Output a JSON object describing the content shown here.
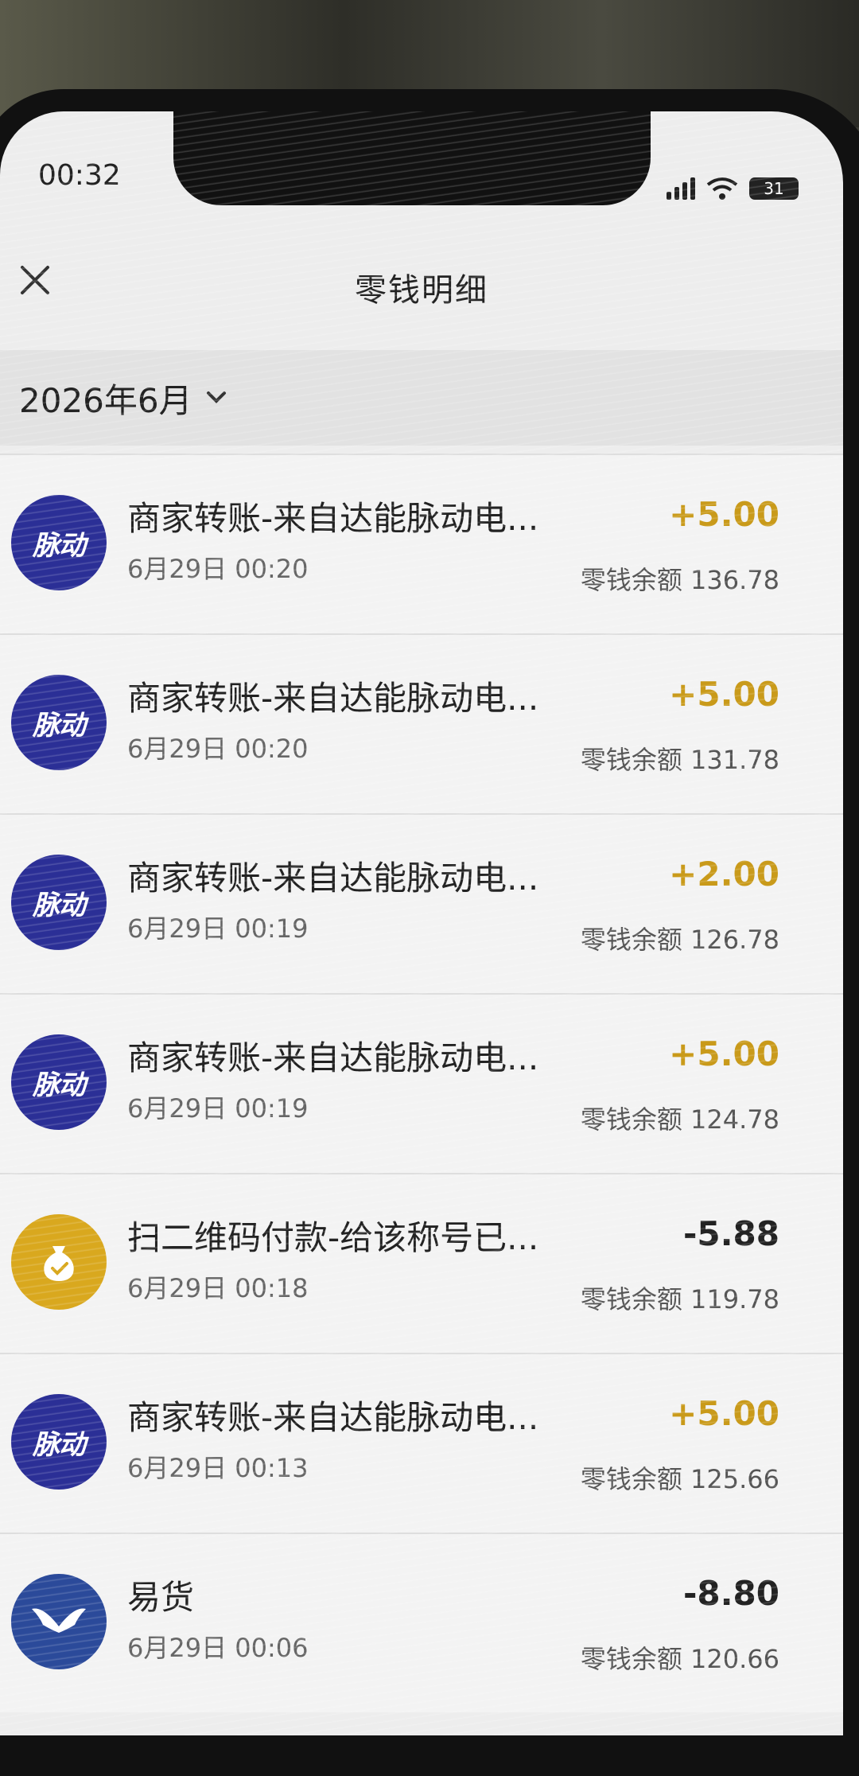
{
  "status_bar": {
    "time": "00:32",
    "battery": "31"
  },
  "nav": {
    "title": "零钱明细"
  },
  "filter": {
    "month": "2026年6月"
  },
  "transactions": [
    {
      "avatar_text": "脉动",
      "avatar_type": "brand",
      "title": "商家转账-来自达能脉动电...",
      "time": "6月29日 00:20",
      "amount": "+5.00",
      "balance": "零钱余额 136.78",
      "direction": "positive"
    },
    {
      "avatar_text": "脉动",
      "avatar_type": "brand",
      "title": "商家转账-来自达能脉动电...",
      "time": "6月29日 00:20",
      "amount": "+5.00",
      "balance": "零钱余额 131.78",
      "direction": "positive"
    },
    {
      "avatar_text": "脉动",
      "avatar_type": "brand",
      "title": "商家转账-来自达能脉动电...",
      "time": "6月29日 00:19",
      "amount": "+2.00",
      "balance": "零钱余额 126.78",
      "direction": "positive"
    },
    {
      "avatar_text": "脉动",
      "avatar_type": "brand",
      "title": "商家转账-来自达能脉动电...",
      "time": "6月29日 00:19",
      "amount": "+5.00",
      "balance": "零钱余额 124.78",
      "direction": "positive"
    },
    {
      "avatar_text": "",
      "avatar_type": "pay",
      "title": "扫二维码付款-给该称号已...",
      "time": "6月29日 00:18",
      "amount": "-5.88",
      "balance": "零钱余额 119.78",
      "direction": "negative"
    },
    {
      "avatar_text": "脉动",
      "avatar_type": "brand",
      "title": "商家转账-来自达能脉动电...",
      "time": "6月29日 00:13",
      "amount": "+5.00",
      "balance": "零钱余额 125.66",
      "direction": "positive"
    },
    {
      "avatar_text": "",
      "avatar_type": "yh",
      "title": "易货",
      "time": "6月29日 00:06",
      "amount": "-8.80",
      "balance": "零钱余额 120.66",
      "direction": "negative"
    }
  ],
  "colors": {
    "brand_avatar": "#2b2f96",
    "pay_avatar": "#d9a81e",
    "positive_amount": "#c99a1a",
    "negative_amount": "#222222"
  },
  "icons": {
    "close": "close-icon",
    "month_dropdown": "chevron-down-icon",
    "pay": "money-bag-icon",
    "yh": "wing-logo-icon"
  }
}
